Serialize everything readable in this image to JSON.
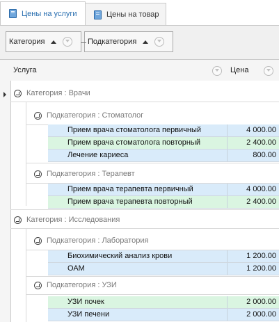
{
  "tabs": [
    {
      "label": "Цены на услуги",
      "icon": "book-icon",
      "active": true
    },
    {
      "label": "Цены на товар",
      "icon": "book-icon",
      "active": false
    }
  ],
  "group_panel": {
    "chips": [
      {
        "label": "Категория"
      },
      {
        "label": "Подкатегория"
      }
    ]
  },
  "columns": {
    "service": "Услуга",
    "price": "Цена"
  },
  "groups": [
    {
      "category": "Категория : Врачи",
      "subgroups": [
        {
          "subcategory": "Подкатегория : Стоматолог",
          "rows": [
            {
              "name": "Прием врача стоматолога первичный",
              "price": "4 000.00"
            },
            {
              "name": "Прием врача стоматолога повторный",
              "price": "2 400.00"
            },
            {
              "name": "Лечение кариеса",
              "price": "800.00"
            }
          ]
        },
        {
          "subcategory": "Подкатегория : Терапевт",
          "rows": [
            {
              "name": "Прием врача терапевта первичный",
              "price": "4 000.00"
            },
            {
              "name": "Прием врача терапевта повторный",
              "price": "2 400.00"
            }
          ]
        }
      ]
    },
    {
      "category": "Категория : Исследования",
      "subgroups": [
        {
          "subcategory": "Подкатегория : Лаборатория",
          "rows": [
            {
              "name": "Биохимический анализ крови",
              "price": "1 200.00"
            },
            {
              "name": "ОАМ",
              "price": "1 200.00"
            }
          ]
        },
        {
          "subcategory": "Подкатегория : УЗИ",
          "rows": [
            {
              "name": "УЗИ почек",
              "price": "2 000.00"
            },
            {
              "name": "УЗИ печени",
              "price": "2 000.00"
            }
          ]
        }
      ]
    }
  ],
  "colors": {
    "row_alt_1": "#d9ebfa",
    "row_alt_2": "#daf5e1",
    "active_tab_text": "#2a6fb0"
  }
}
